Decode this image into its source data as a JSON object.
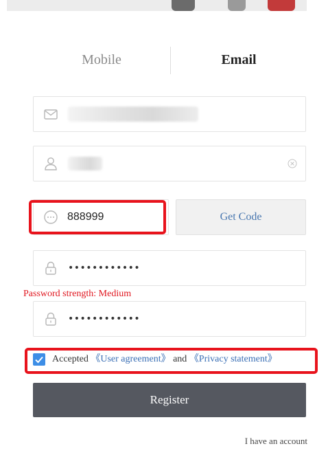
{
  "tabs": {
    "mobile": "Mobile",
    "email": "Email",
    "active": "Email"
  },
  "fields": {
    "verification_code": "888999",
    "password_mask": "••••••••••••",
    "confirm_password_mask": "••••••••••••"
  },
  "get_code_button": "Get Code",
  "password_strength": "Password strength: Medium",
  "agreement": {
    "checked": true,
    "prefix": "Accepted",
    "user_agreement": "《User agreement》",
    "conjunction": "and",
    "privacy_statement": "《Privacy statement》"
  },
  "register_button": "Register",
  "have_account_link": "I have an account",
  "colors": {
    "link": "#3a6fb5",
    "warning": "#e0161f",
    "highlight_box": "#e8131c",
    "register_bg": "#555860",
    "checkbox": "#3d8ee6"
  }
}
